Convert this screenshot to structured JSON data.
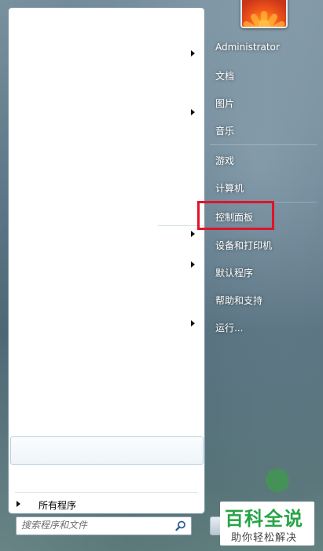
{
  "right_menu": {
    "user_name": "Administrator",
    "items": [
      {
        "label": "文档"
      },
      {
        "label": "图片"
      },
      {
        "label": "音乐"
      },
      {
        "label": "游戏"
      },
      {
        "label": "计算机"
      },
      {
        "label": "控制面板"
      },
      {
        "label": "设备和打印机"
      },
      {
        "label": "默认程序"
      },
      {
        "label": "帮助和支持"
      },
      {
        "label": "运行..."
      }
    ]
  },
  "left_pane": {
    "all_programs_label": "所有程序"
  },
  "search": {
    "placeholder": "搜索程序和文件"
  },
  "logo": {
    "title": "百科全说",
    "subtitle": "助你轻松解决"
  },
  "colors": {
    "highlight_border": "#e0142a",
    "logo_green": "#27a447"
  }
}
